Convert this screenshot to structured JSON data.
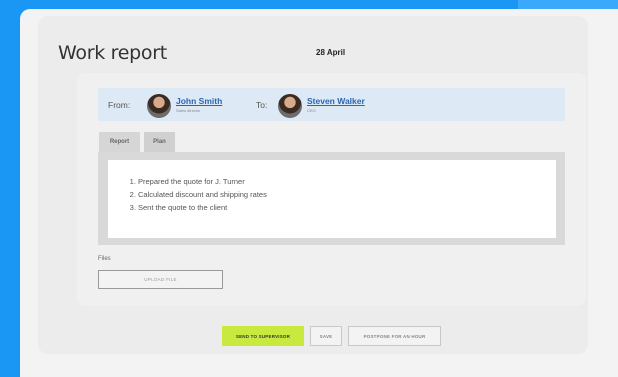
{
  "report": {
    "title": "Work report",
    "date": "28 April"
  },
  "people": {
    "from_label": "From:",
    "to_label": "To:",
    "from": {
      "name": "John Smith",
      "role": "Sales director"
    },
    "to": {
      "name": "Steven Walker",
      "role": "CEO"
    }
  },
  "tabs": [
    {
      "label": "Report",
      "active": true
    },
    {
      "label": "Plan",
      "active": false
    }
  ],
  "report_items": [
    "Prepared the quote for J. Turner",
    "Calculated discount and shipping rates",
    "Sent the quote to the client"
  ],
  "files": {
    "label": "Files",
    "upload_label": "UPLOAD FILE"
  },
  "actions": {
    "send": "SEND TO SUPERVISOR",
    "save": "SAVE",
    "postpone": "POSTPONE FOR AN HOUR"
  },
  "colors": {
    "background": "#1a97f5",
    "people_bar": "#dde9f4",
    "primary_button": "#c8ea3e",
    "link": "#2a66b5"
  }
}
